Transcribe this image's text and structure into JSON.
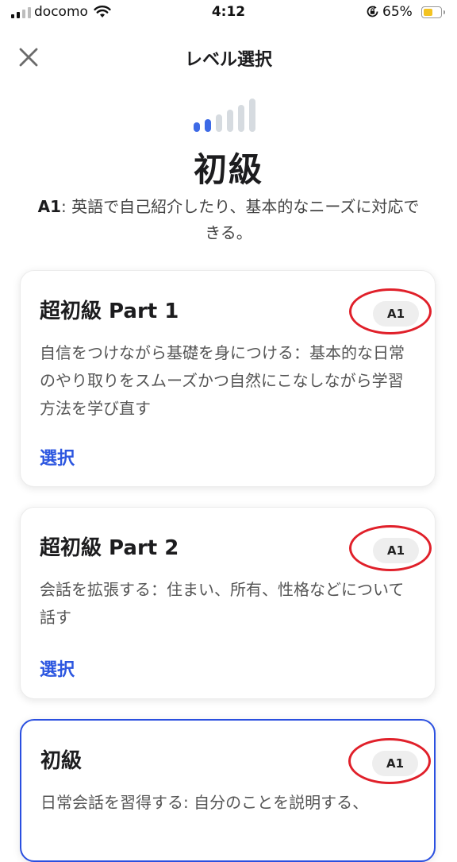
{
  "status_bar": {
    "carrier": "docomo",
    "time": "4:12",
    "battery_percent": "65%",
    "battery_level": 0.65,
    "battery_color": "#f3c321"
  },
  "nav": {
    "close_icon": "close-icon",
    "title": "レベル選択"
  },
  "level": {
    "bars_total": 6,
    "bars_active": 2,
    "accent_color": "#3d6ae6",
    "name": "初級",
    "code": "A1",
    "description": ": 英語で自己紹介したり、基本的なニーズに対応できる。"
  },
  "courses": [
    {
      "title": "超初級 Part 1",
      "badge": "A1",
      "description": "自信をつけながら基礎を身につける：基本的な日常のやり取りをスムーズかつ自然にこなしながら学習方法を学び直す",
      "select_label": "選択"
    },
    {
      "title": "超初級 Part 2",
      "badge": "A1",
      "description": "会話を拡張する：住まい、所有、性格などについて話す",
      "select_label": "選択"
    },
    {
      "title": "初級",
      "badge": "A1",
      "description": "日常会話を習得する: 自分のことを説明する、",
      "selected": true
    }
  ],
  "colors": {
    "link": "#2c56e0",
    "highlight_ring": "#e0202a",
    "selected_border": "#2a4fe0"
  }
}
